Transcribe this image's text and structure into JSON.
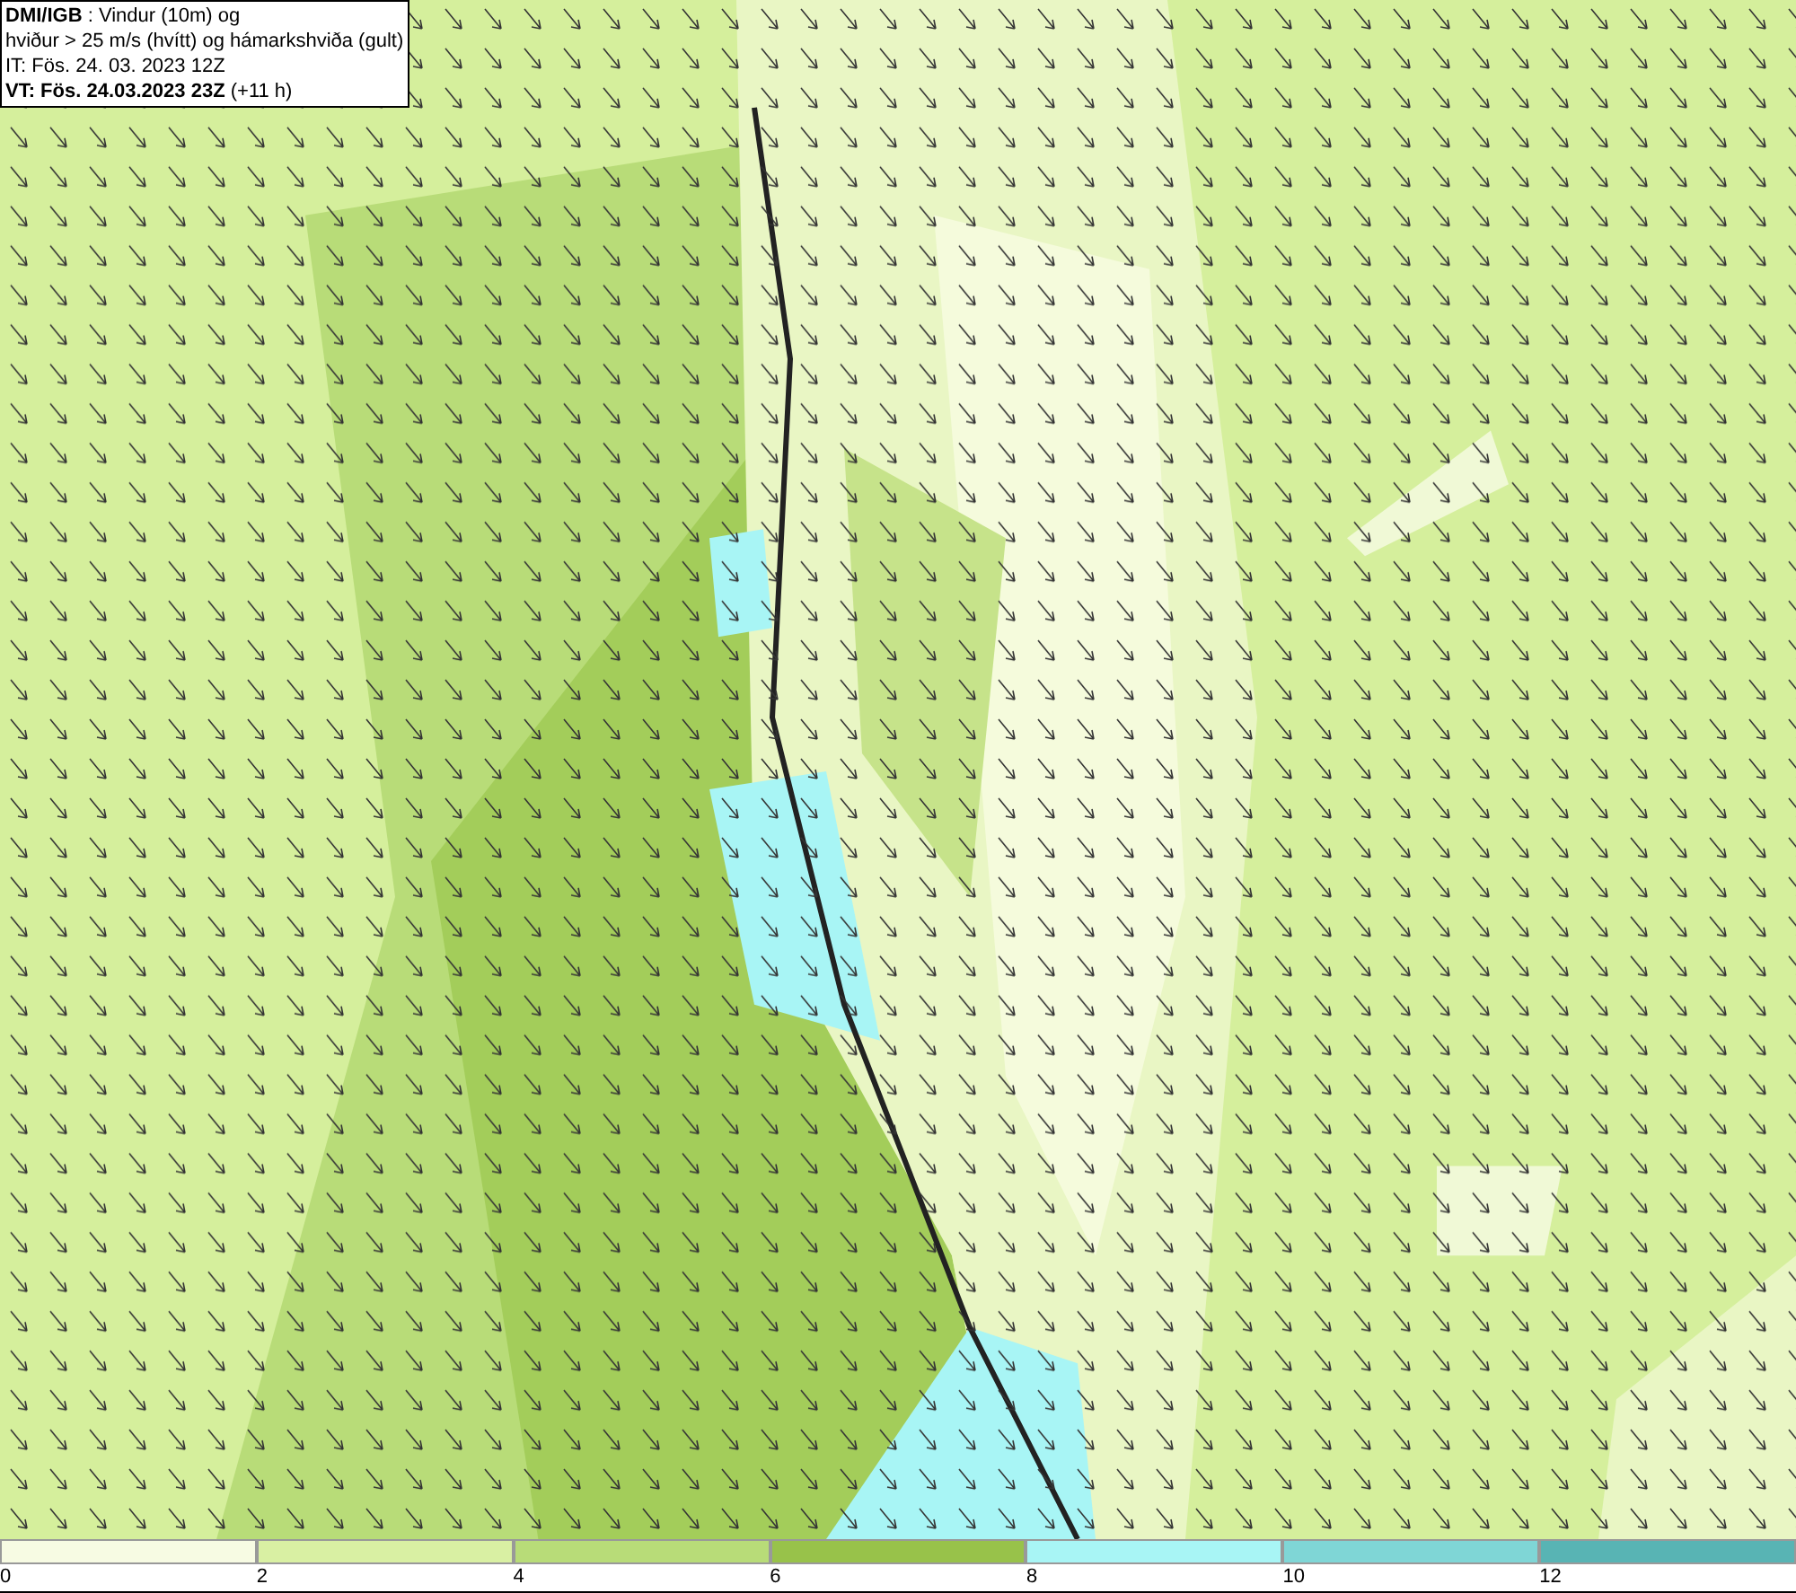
{
  "legend_box": {
    "lines": [
      "**DMI/IGB** : Vindur (10m) og",
      "hviður > 25 m/s (hvítt) og hámarkshviða (gult)",
      "IT: Fös. 24. 03. 2023 12Z",
      "**VT: Fös. 24.03.2023 23Z** (+11 h)"
    ]
  },
  "colorbar": [
    {
      "label": "0",
      "color": "#f7fbe3"
    },
    {
      "label": "2",
      "color": "#d9f0a3"
    },
    {
      "label": "4",
      "color": "#b8dc78"
    },
    {
      "label": "6",
      "color": "#98c24a"
    },
    {
      "label": "8",
      "color": "#a8f5f5"
    },
    {
      "label": "10",
      "color": "#7fd6d6"
    },
    {
      "label": "12",
      "color": "#58b4b4"
    }
  ]
}
